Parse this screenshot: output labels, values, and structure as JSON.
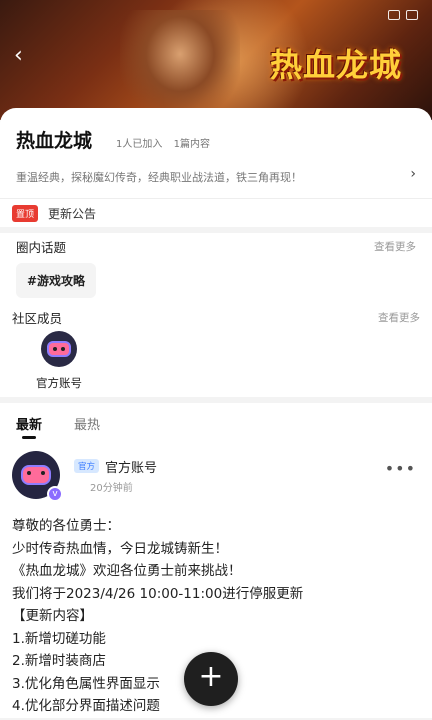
{
  "header": {
    "back_icon": "back-arrow-icon",
    "game_logo": "热血龙城"
  },
  "circle": {
    "title": "热血龙城",
    "members_joined": "1人已加入",
    "posts_count": "1篇内容",
    "description": "重温经典，探秘魔幻传奇，经典职业战法道，铁三角再现！"
  },
  "notice": {
    "badge": "置顶",
    "text": "更新公告"
  },
  "topics": {
    "label": "圈内话题",
    "more": "查看更多",
    "chip": "#游戏攻略"
  },
  "members": {
    "label": "社区成员",
    "more": "查看更多",
    "items": [
      {
        "name": "官方账号"
      }
    ]
  },
  "tabs": [
    {
      "label": "最新",
      "active": true
    },
    {
      "label": "最热",
      "active": false
    }
  ],
  "post": {
    "official_badge": "官方",
    "author": "官方账号",
    "time": "20分钟前",
    "lines": [
      "尊敬的各位勇士：",
      "少时传奇热血情，今日龙城铸新生！",
      "《热血龙城》欢迎各位勇士前来挑战！",
      "我们将于2023/4/26 10:00-11:00进行停服更新",
      "【更新内容】",
      "1.新增切磋功能",
      "2.新增时装商店",
      "3.优化角色属性界面显示",
      "4.优化部分界面描述问题"
    ]
  },
  "fab": {
    "label": "+"
  },
  "colors": {
    "notice_badge": "#e83b31",
    "official_badge_bg": "#d7e8ff",
    "official_badge_text": "#3a7bff",
    "logo_gold": "#ffcf3a"
  }
}
